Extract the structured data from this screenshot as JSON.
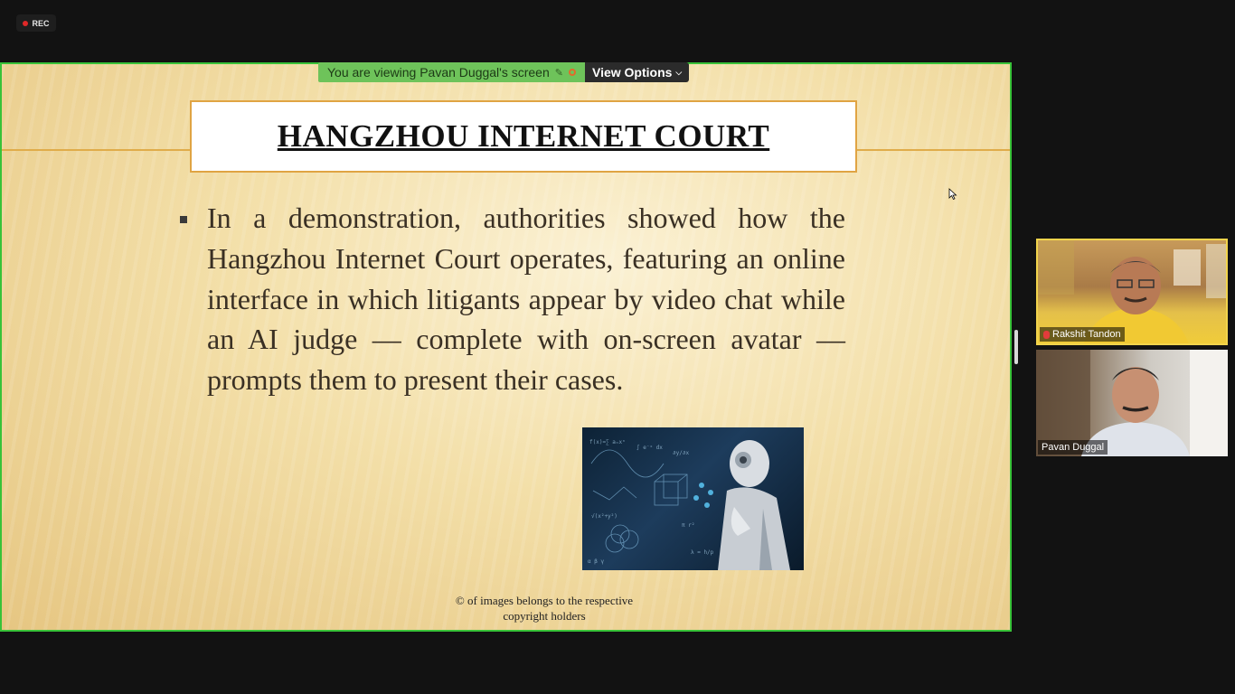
{
  "recording": {
    "label": "REC"
  },
  "screen_share": {
    "banner_text": "You are viewing Pavan Duggal's screen",
    "view_options_label": "View Options",
    "colors": {
      "banner": "#6ec35a",
      "share_border": "#38c238"
    }
  },
  "slide": {
    "title": "HANGZHOU INTERNET COURT",
    "bullet": "In a demonstration, authorities showed how the Hangzhou Internet Court operates, featuring an online interface in which litigants appear by video chat while an AI judge — complete with on-screen avatar — prompts them to present their cases.",
    "image_alt": "AI robot thinking in front of equations",
    "copyright_line1": "© of images belongs to the respective",
    "copyright_line2": "copyright holders"
  },
  "participants": [
    {
      "name": "Rakshit Tandon",
      "muted": true,
      "active_speaker": true
    },
    {
      "name": "Pavan Duggal",
      "muted": false,
      "active_speaker": false
    }
  ],
  "icons": {
    "recording": "record-dot-icon",
    "banner_pin": "pin-icon",
    "banner_stop": "stop-share-icon",
    "dropdown": "chevron-down-icon",
    "cursor": "mouse-cursor-icon",
    "mic_muted": "mic-muted-icon"
  }
}
